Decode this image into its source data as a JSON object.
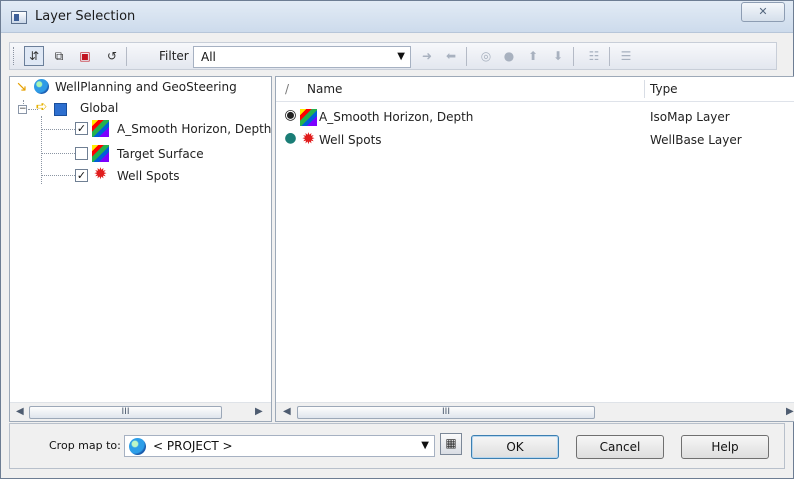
{
  "window": {
    "title": "Layer Selection",
    "close_label": "✕",
    "colors": {
      "chrome": "#f0f0f0",
      "title_bar": "#cddbec",
      "selection": "#dfe8f5",
      "ok_border": "#3c7fb1"
    }
  },
  "toolbar": {
    "buttons": [
      {
        "name": "sort-list-icon",
        "label": "⇵"
      },
      {
        "name": "copy-layers-icon",
        "label": "⧉"
      },
      {
        "name": "color-layers-icon",
        "label": "▣"
      },
      {
        "name": "refresh-icon",
        "label": "↺"
      }
    ],
    "filter_label": "Filter",
    "filter_value": "All",
    "navigation_icons": [
      "➜",
      "⬅",
      "◎",
      "●",
      "⬆",
      "⬇",
      "☷",
      "☰"
    ]
  },
  "tree": {
    "root": "WellPlanning and GeoSteering",
    "global": "Global",
    "items": [
      {
        "label": "A_Smooth Horizon, Depth",
        "checked": true,
        "icon": "map-icon"
      },
      {
        "label": "Target Surface",
        "checked": false,
        "icon": "map-icon"
      },
      {
        "label": "Well Spots",
        "checked": true,
        "icon": "spot-icon"
      }
    ],
    "scroll_thumb": "III"
  },
  "list": {
    "sort_marker": "/",
    "columns": [
      "Name",
      "Type"
    ],
    "rows": [
      {
        "name": "A_Smooth Horizon, Depth",
        "type": "IsoMap Layer",
        "state_icon": "eye-icon",
        "layer_icon": "map-icon"
      },
      {
        "name": "Well Spots",
        "type": "WellBase Layer",
        "state_icon": "dot-icon",
        "layer_icon": "spot-icon"
      }
    ],
    "scroll_thumb": "III"
  },
  "bottom": {
    "crop_label": "Crop map to:",
    "crop_value": "< PROJECT >",
    "buttons": {
      "ok": "OK",
      "cancel": "Cancel",
      "help": "Help"
    }
  }
}
